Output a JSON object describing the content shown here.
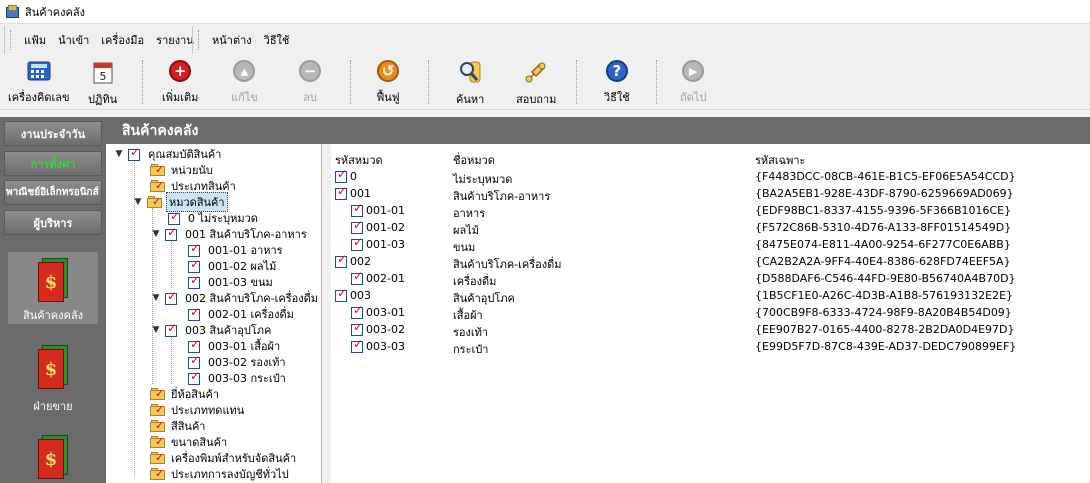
{
  "window": {
    "title": "สินค้าคงคลัง"
  },
  "menu": {
    "group1": [
      "แฟ้ม",
      "นำเข้า",
      "เครื่องมือ",
      "รายงาน"
    ],
    "group2": [
      "หน้าต่าง",
      "วิธีใช้"
    ]
  },
  "toolbar": {
    "calculator": "เครื่องคิดเลข",
    "calendar": "ปฏิทิน",
    "calendar_day": "5",
    "add": "เพิ่มเติม",
    "edit": "แก้ไข",
    "delete": "ลบ",
    "restore": "ฟื้นฟู",
    "search": "ค้นหา",
    "inquiry": "สอบถาม",
    "help": "วิธีใช้",
    "next": "ถัดไป"
  },
  "sidebar": {
    "buttons": [
      "งานประจำวัน",
      "การตั้งค่า",
      "พาณิชย์อิเล็กทรอนิกส์",
      "ผู้บริหาร"
    ],
    "modules": [
      "สินค้าคงคลัง",
      "ฝ่ายขาย",
      ""
    ]
  },
  "main": {
    "header": "สินค้าคงคลัง"
  },
  "tree": {
    "root": "คุณสมบัติสินค้า",
    "unit": "หน่วยนับ",
    "product_type": "ประเภทสินค้า",
    "category": "หมวดสินค้า",
    "c0": "0 ไม่ระบุหมวด",
    "c001": "001 สินค้าบริโภค-อาหาร",
    "c001_01": "001-01 อาหาร",
    "c001_02": "001-02 ผลไม้",
    "c001_03": "001-03 ขนม",
    "c002": "002 สินค้าบริโภค-เครื่องดื่ม",
    "c002_01": "002-01 เครื่องดื่ม",
    "c003": "003 สินค้าอุปโภค",
    "c003_01": "003-01 เสื้อผ้า",
    "c003_02": "003-02 รองเท้า",
    "c003_03": "003-03 กระเป๋า",
    "brand": "ยี่ห้อสินค้า",
    "substitute": "ประเภททดแทน",
    "color": "สีสินค้า",
    "size": "ขนาดสินค้า",
    "label_printer": "เครื่องพิมพ์สำหรับจัดสินค้า",
    "gl_type": "ประเภทการลงบัญชีทั่วไป"
  },
  "grid": {
    "columns": [
      "รหัสหมวด",
      "ชื่อหมวด",
      "รหัสเฉพาะ"
    ],
    "rows": [
      {
        "code": "0",
        "name": "ไม่ระบุหมวด",
        "guid": "{F4483DCC-08CB-461E-B1C5-EF06E5A54CCD}"
      },
      {
        "code": "001",
        "name": "สินค้าบริโภค-อาหาร",
        "guid": "{BA2A5EB1-928E-43DF-8790-6259669AD069}"
      },
      {
        "code": "001-01",
        "name": "อาหาร",
        "guid": "{EDF98BC1-8337-4155-9396-5F366B1016CE}"
      },
      {
        "code": "001-02",
        "name": "ผลไม้",
        "guid": "{F572C86B-5310-4D76-A133-8FF01514549D}"
      },
      {
        "code": "001-03",
        "name": "ขนม",
        "guid": "{8475E074-E811-4A00-9254-6F277C0E6ABB}"
      },
      {
        "code": "002",
        "name": "สินค้าบริโภค-เครื่องดื่ม",
        "guid": "{CA2B2A2A-9FF4-40E4-8386-628FD74EEF5A}"
      },
      {
        "code": "002-01",
        "name": "เครื่องดื่ม",
        "guid": "{D588DAF6-C546-44FD-9E80-B56740A4B70D}"
      },
      {
        "code": "003",
        "name": "สินค้าอุปโภค",
        "guid": "{1B5CF1E0-A26C-4D3B-A1B8-576193132E2E}"
      },
      {
        "code": "003-01",
        "name": "เสื้อผ้า",
        "guid": "{700CB9F8-6333-4724-98F9-8A20B4B54D09}"
      },
      {
        "code": "003-02",
        "name": "รองเท้า",
        "guid": "{EE907B27-0165-4400-8278-2B2DA0D4E97D}"
      },
      {
        "code": "003-03",
        "name": "กระเป๋า",
        "guid": "{E99D5F7D-87C8-439E-AD37-DEDC790899EF}"
      }
    ]
  },
  "colors": {
    "sidebar": "#6b6b6b",
    "active_sidebar_text": "#3dd13d",
    "selection": "#cde3f7"
  }
}
